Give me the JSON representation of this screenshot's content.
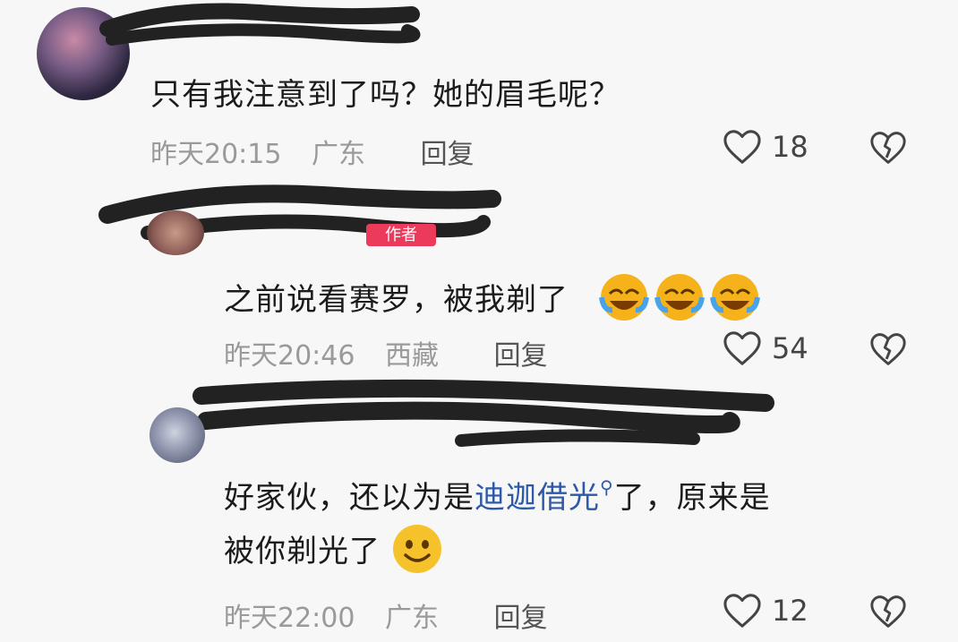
{
  "comments": [
    {
      "text": "只有我注意到了吗？她的眉毛呢？",
      "time": "昨天20:15",
      "location": "广东",
      "reply_label": "回复",
      "likes": "18"
    },
    {
      "badge": "作者",
      "text": "之前说看赛罗，被我剃了",
      "time": "昨天20:46",
      "location": "西藏",
      "reply_label": "回复",
      "likes": "54"
    },
    {
      "text_pre": "好家伙，还以为是",
      "link": "迪迦借光",
      "text_post": "了，原来是",
      "text_line2": "被你剃光了",
      "time": "昨天22:00",
      "location": "广东",
      "reply_label": "回复",
      "likes": "12"
    }
  ],
  "icons": {
    "like": "heart-outline-icon",
    "dislike": "broken-heart-icon",
    "search": "search-icon",
    "emoji_laugh": "laughing-crying-emoji",
    "emoji_smile": "smiling-emoji"
  },
  "colors": {
    "link": "#2d5aa8",
    "badge": "#ec3a5b",
    "meta": "#9a9a9a"
  }
}
